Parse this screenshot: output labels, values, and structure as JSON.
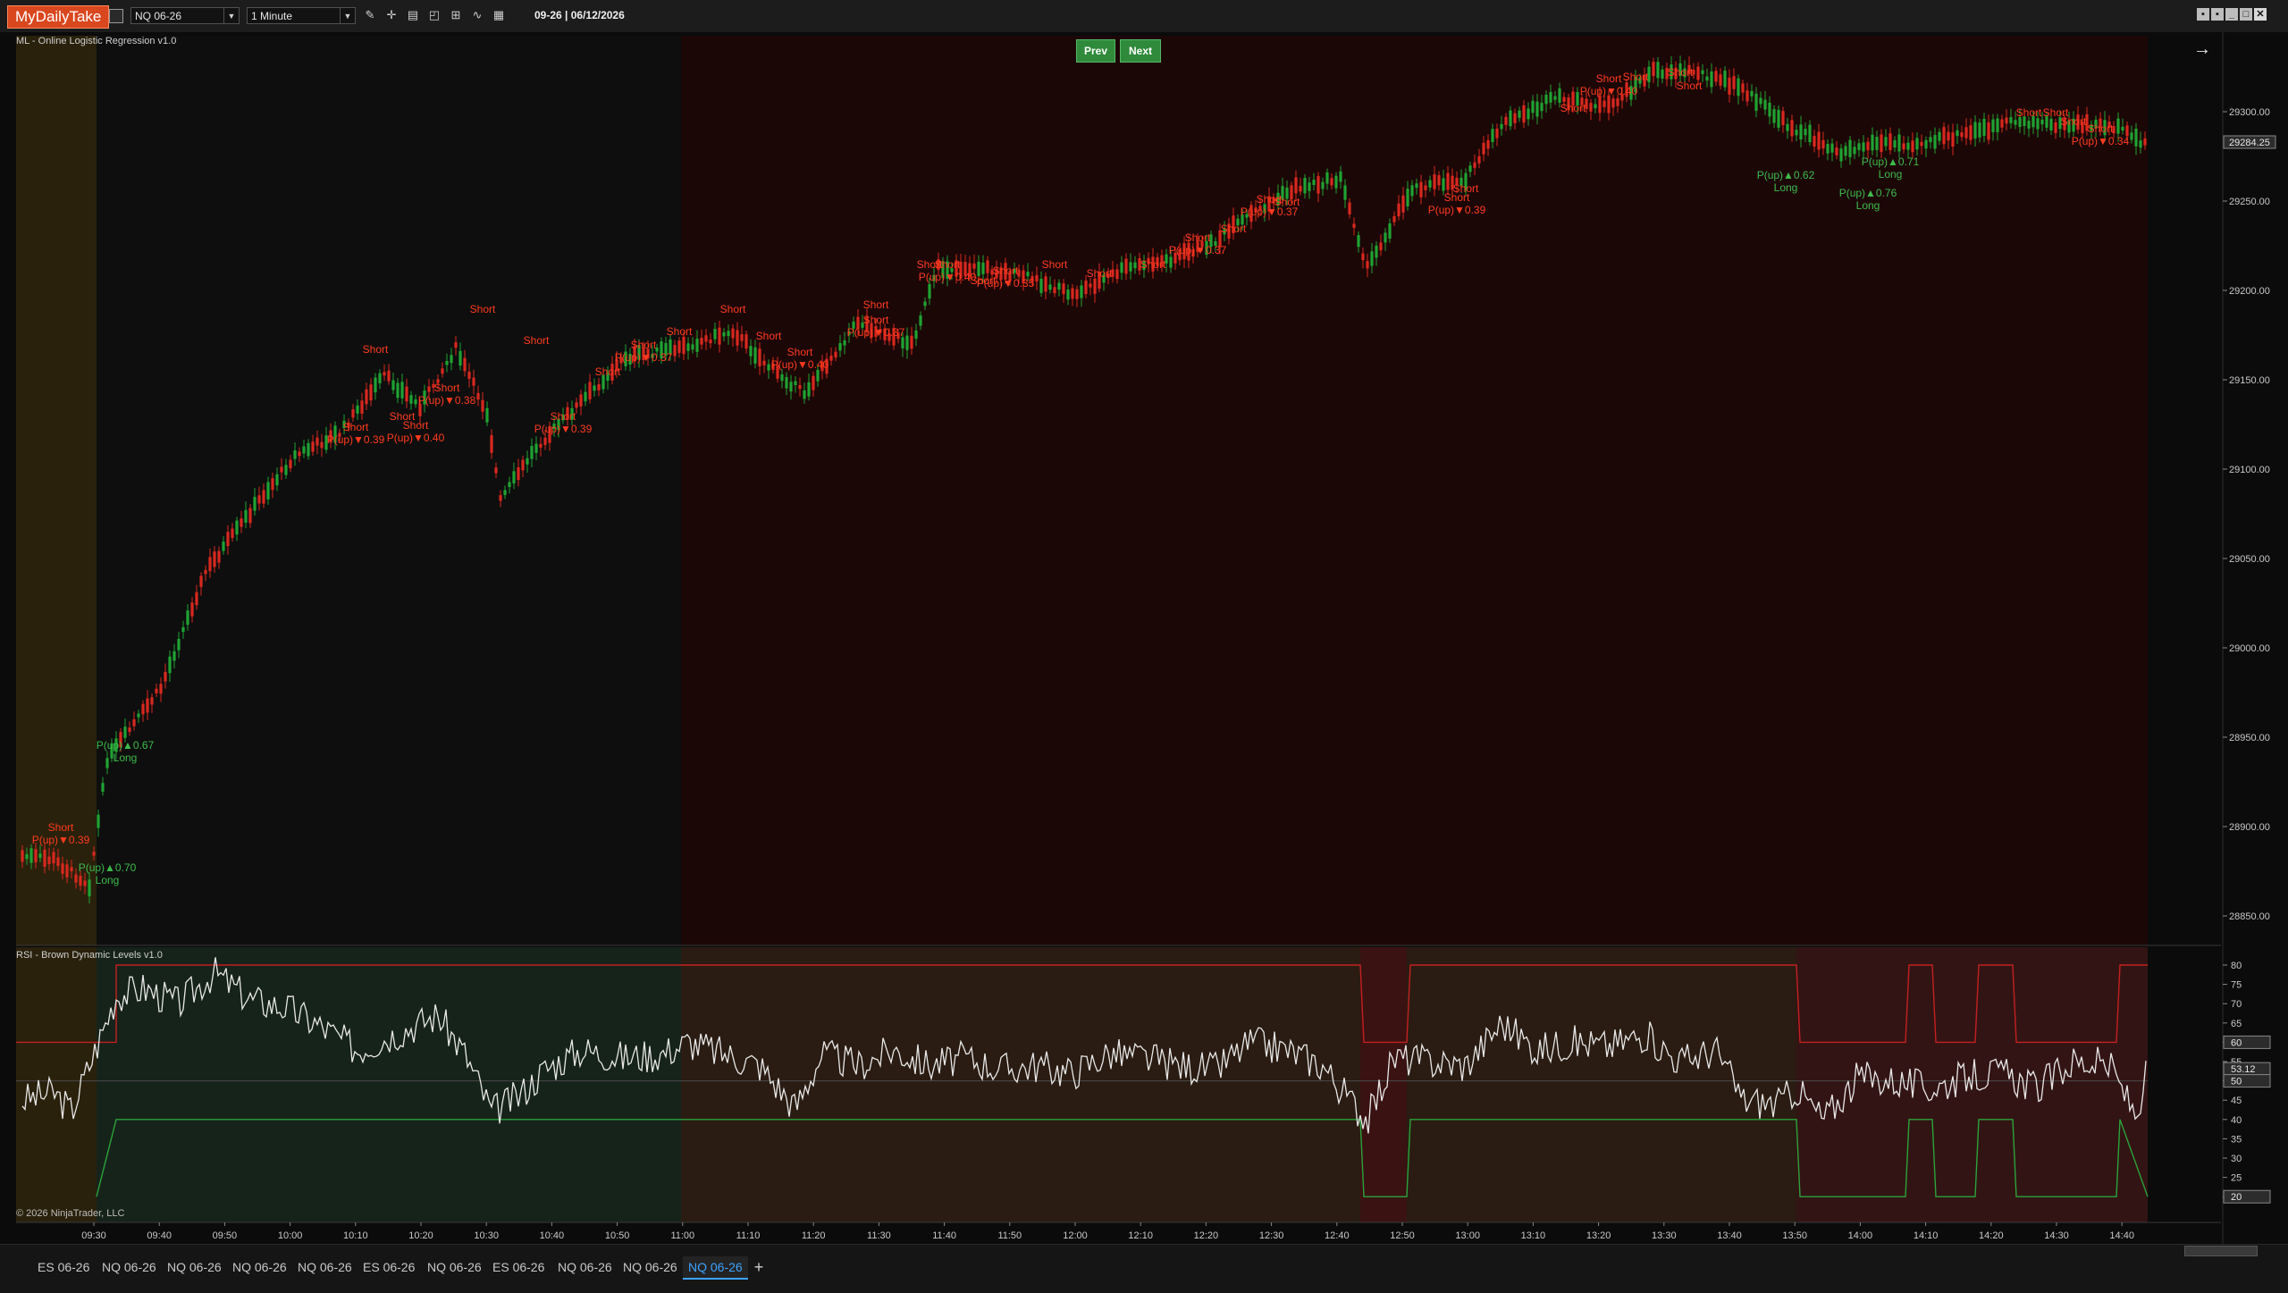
{
  "toolbar": {
    "brand": "MyDailyTake",
    "instrument": "NQ 06-26",
    "interval": "1 Minute",
    "date": "09-26 | 06/12/2026"
  },
  "main_panel": {
    "label": "ML - Online Logistic Regression v1.0",
    "prev_label": "Prev",
    "next_label": "Next",
    "last_price": "29284.25",
    "price_ticks": [
      "29300.00",
      "29250.00",
      "29200.00",
      "29150.00",
      "29100.00",
      "29050.00",
      "29000.00",
      "28950.00",
      "28900.00",
      "28850.00"
    ],
    "signals": [
      {
        "t": "Short",
        "p": "P(up)▼0.39",
        "side": "short"
      },
      {
        "t": "Long",
        "p": "P(up)▲0.70",
        "side": "long"
      },
      {
        "t": "Long",
        "p": "P(up)▲0.67",
        "side": "long"
      },
      {
        "t": "Short",
        "p": "P(up)▼0.39",
        "side": "short"
      },
      {
        "t": "Short",
        "p": "P(up)▼0.40",
        "side": "short"
      },
      {
        "t": "Short",
        "p": "P(up)▼0.38",
        "side": "short"
      },
      {
        "t": "Short",
        "p": "P(up)▼0.39",
        "side": "short"
      },
      {
        "t": "Short",
        "p": "P(up)▼0.37",
        "side": "short"
      },
      {
        "t": "Short",
        "p": "P(up)▼0.40",
        "side": "short"
      },
      {
        "t": "Short",
        "p": "P(up)▼0.37",
        "side": "short"
      },
      {
        "t": "Short",
        "p": "P(up)▼0.40",
        "side": "short"
      },
      {
        "t": "Short",
        "p": "P(up)▼0.35",
        "side": "short"
      },
      {
        "t": "Short",
        "p": "P(up)▼0.37",
        "side": "short"
      },
      {
        "t": "Short",
        "p": "P(up)▼0.37",
        "side": "short"
      },
      {
        "t": "Short",
        "p": "P(up)▼0.39",
        "side": "short"
      },
      {
        "t": "Short",
        "p": "P(up)▼0.40",
        "side": "short"
      },
      {
        "t": "Long",
        "p": "P(up)▲0.62",
        "side": "long"
      },
      {
        "t": "Long",
        "p": "P(up)▲0.76",
        "side": "long"
      },
      {
        "t": "Long",
        "p": "P(up)▲0.71",
        "side": "long"
      },
      {
        "t": "Short",
        "p": "P(up)▼0.34",
        "side": "short"
      }
    ]
  },
  "rsi_panel": {
    "label": "RSI - Brown Dynamic Levels v1.0",
    "ticks": [
      "80",
      "75",
      "70",
      "65",
      "60",
      "55",
      "50",
      "45",
      "40",
      "35",
      "30",
      "25",
      "20"
    ],
    "upper_badge": "60",
    "mid_badge": "50",
    "value_badge": "53.12",
    "lower_badge": "20"
  },
  "time_axis": [
    "09:30",
    "09:40",
    "09:50",
    "10:00",
    "10:10",
    "10:20",
    "10:30",
    "10:40",
    "10:50",
    "11:00",
    "11:10",
    "11:20",
    "11:30",
    "11:40",
    "11:50",
    "12:00",
    "12:10",
    "12:20",
    "12:30",
    "12:40",
    "12:50",
    "13:00",
    "13:10",
    "13:20",
    "13:30",
    "13:40",
    "13:50",
    "14:00",
    "14:10",
    "14:20",
    "14:30",
    "14:40"
  ],
  "copyright": "© 2026 NinjaTrader, LLC",
  "tabs": [
    {
      "label": "ES 06-26",
      "active": false
    },
    {
      "label": "NQ 06-26",
      "active": false
    },
    {
      "label": "NQ 06-26",
      "active": false
    },
    {
      "label": "NQ 06-26",
      "active": false
    },
    {
      "label": "NQ 06-26",
      "active": false
    },
    {
      "label": "ES 06-26",
      "active": false
    },
    {
      "label": "NQ 06-26",
      "active": false
    },
    {
      "label": "ES 06-26",
      "active": false
    },
    {
      "label": "NQ 06-26",
      "active": false
    },
    {
      "label": "NQ 06-26",
      "active": false
    },
    {
      "label": "NQ 06-26",
      "active": true
    }
  ],
  "colors": {
    "up": "#1fa332",
    "down": "#d9281e",
    "long_text": "#3dbb4b",
    "short_text": "#ff3b1f",
    "rsi_line": "#e8e8e8"
  }
}
